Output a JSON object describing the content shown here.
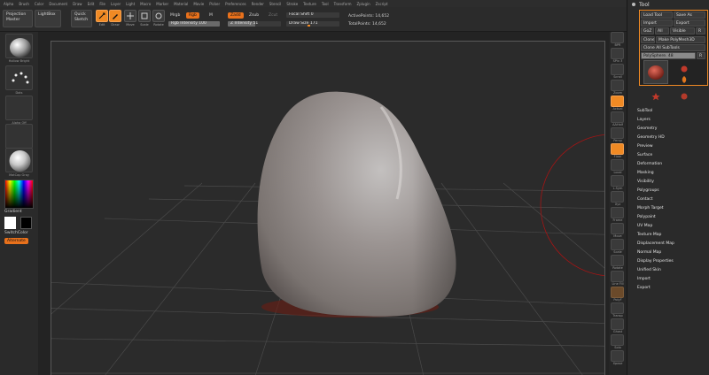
{
  "menubar": [
    "Alpha",
    "Brush",
    "Color",
    "Document",
    "Draw",
    "Edit",
    "File",
    "Layer",
    "Light",
    "Macro",
    "Marker",
    "Material",
    "Movie",
    "Picker",
    "Preferences",
    "Render",
    "Stencil",
    "Stroke",
    "Texture",
    "Tool",
    "Transform",
    "Zplugin",
    "Zscript"
  ],
  "top": {
    "projection_master": "Projection Master",
    "lightbox": "LightBox",
    "quick_sketch": "Quick Sketch",
    "tools": [
      "Edit",
      "Draw",
      "Move",
      "Scale",
      "Rotate"
    ],
    "mrgb": "Mrgb",
    "rgb": "Rgb",
    "m": "M",
    "zadd": "Zadd",
    "zsub": "Zsub",
    "zcut": "Zcut",
    "rgb_intensity": "Rgb Intensity 100",
    "rgb_intensity_value": 1.0,
    "z_intensity": "Z Intensity 51",
    "z_intensity_value": 0.51,
    "focal_shift": "Focal Shift 0",
    "draw_size": "Draw Size 171",
    "draw_size_value": 0.4,
    "active_points": "ActivePoints: 14,652",
    "total_points": "TotalPoints: 14,652"
  },
  "left": {
    "brush_caption": "Hollow Bright",
    "stroke_caption": "Dots",
    "alpha_caption": "Alpha Off",
    "texture_caption": "Texture Off",
    "material_caption": "MatCap Gray",
    "gradient": "Gradient",
    "switch_color": "SwitchColor",
    "alternate": "Alternate",
    "colors": {
      "main": "#ffffff",
      "secondary": "#000000"
    }
  },
  "right_shelf": [
    "BPR",
    "SPix 3",
    "Scroll",
    "Zoom",
    "Actual",
    "AAHalf",
    "Persp",
    "Floor",
    "Local",
    "L.Sym",
    "Xyz",
    "Frame",
    "Move",
    "Scale",
    "Rotate",
    "Line Fill",
    "PolyF",
    "Transp",
    "Ghost",
    "Solo",
    "Xpose"
  ],
  "tool": {
    "title": "Tool",
    "load_tool": "Load Tool",
    "save_as": "Save As",
    "import": "Import",
    "export": "Export",
    "goz": "GoZ",
    "all": "All",
    "visible": "Visible",
    "r": "R",
    "clone": "Clone",
    "make_polymesh": "Make PolyMesh3D",
    "clone_all_subtools": "Clone All SubTools",
    "current_tool": "PolySphere. 48",
    "slot_r": "R",
    "tool_thumbs": [
      "PolySphere",
      "Sphere3D",
      "SimpleBrush",
      "PolyMesh3D",
      "PolySphere"
    ],
    "menu": [
      "SubTool",
      "Layers",
      "Geometry",
      "Geometry HD",
      "Preview",
      "Surface",
      "Deformation",
      "Masking",
      "Visibility",
      "Polygroups",
      "Contact",
      "Morph Target",
      "Polypaint",
      "UV Map",
      "Texture Map",
      "Displacement Map",
      "Normal Map",
      "Display Properties",
      "Unified Skin",
      "Import",
      "Export"
    ]
  },
  "colors": {
    "accent": "#f08a24",
    "panel": "#2a2a2a",
    "canvas": "#2b2b2b",
    "model": "#8e8784"
  }
}
